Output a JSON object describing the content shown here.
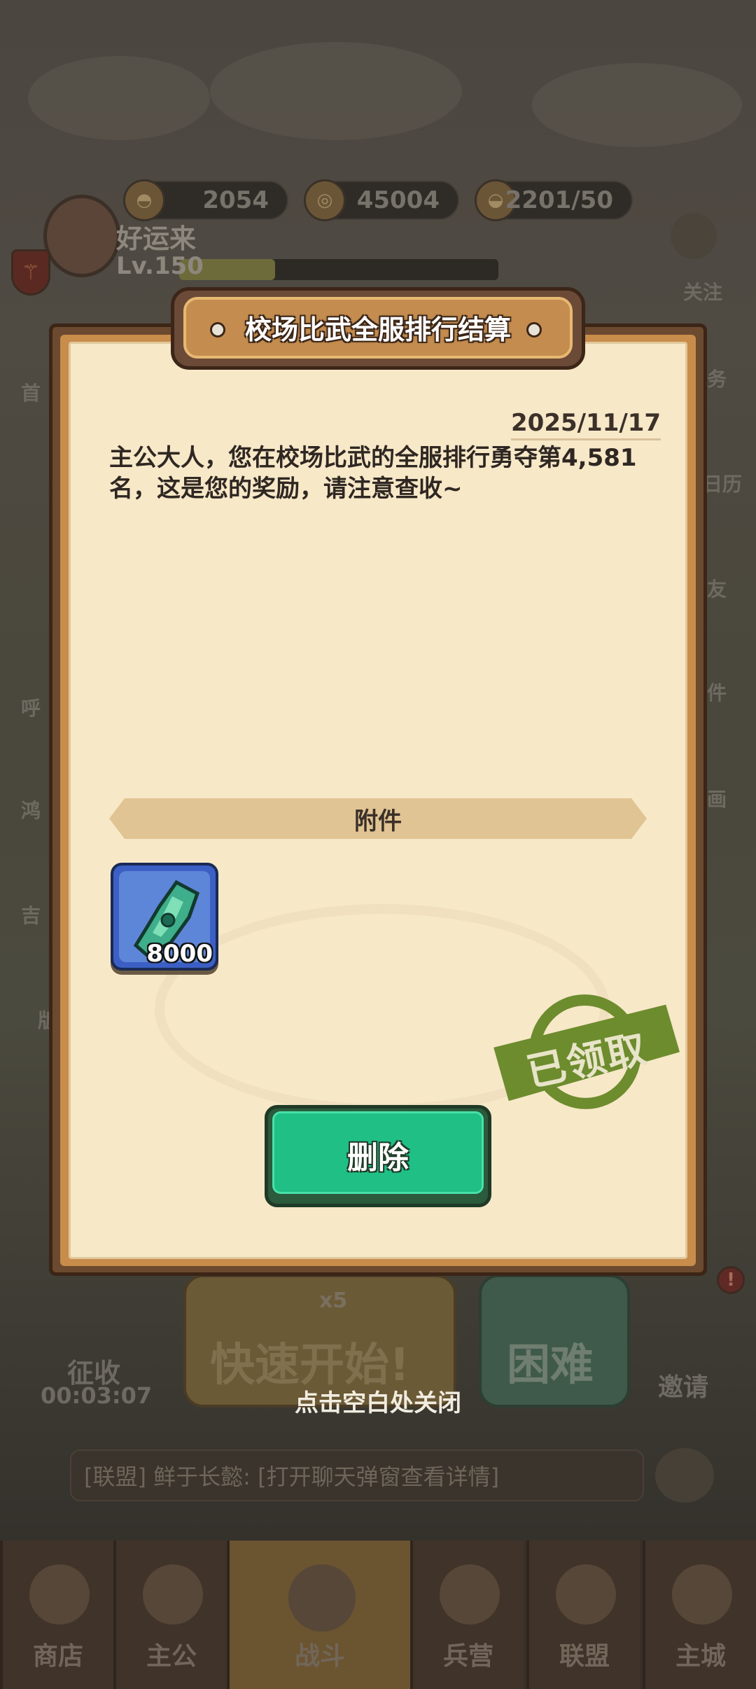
{
  "hud": {
    "resources": [
      {
        "icon": "gold-ingot-icon",
        "value": "2054"
      },
      {
        "icon": "coin-icon",
        "value": "45004"
      },
      {
        "icon": "food-bowl-icon",
        "value": "2201/50"
      }
    ],
    "player": {
      "name": "好运来",
      "level": "Lv.150",
      "xp_fraction": 0.3
    },
    "right_follow_label": "关注"
  },
  "side_right": [
    "务",
    "日历",
    "友",
    "件",
    "画"
  ],
  "side_left": [
    "首",
    "呼",
    "鸿",
    "吉",
    "版"
  ],
  "mail": {
    "title": "校场比武全服排行结算",
    "date": "2025/11/17",
    "body": "主公大人，您在校场比武的全服排行勇夺第4,581名，这是您的奖励，请注意查收~",
    "attachment_header": "附件",
    "attachment_item": {
      "icon": "jade-token-icon",
      "quantity": "8000"
    },
    "stamp": "已领取",
    "delete_button": "删除"
  },
  "behind": {
    "collect_label": "征收",
    "collect_timer": "00:03:07",
    "quick_start": "快速开始!",
    "quick_start_cost": "x5",
    "difficulty": "困难",
    "invite": "邀请",
    "chat_text": "[联盟] 鲜于长懿: [打开聊天弹窗查看详情]"
  },
  "close_hint": "点击空白处关闭",
  "tabs": [
    "商店",
    "主公",
    "战斗",
    "兵营",
    "联盟",
    "主城"
  ]
}
